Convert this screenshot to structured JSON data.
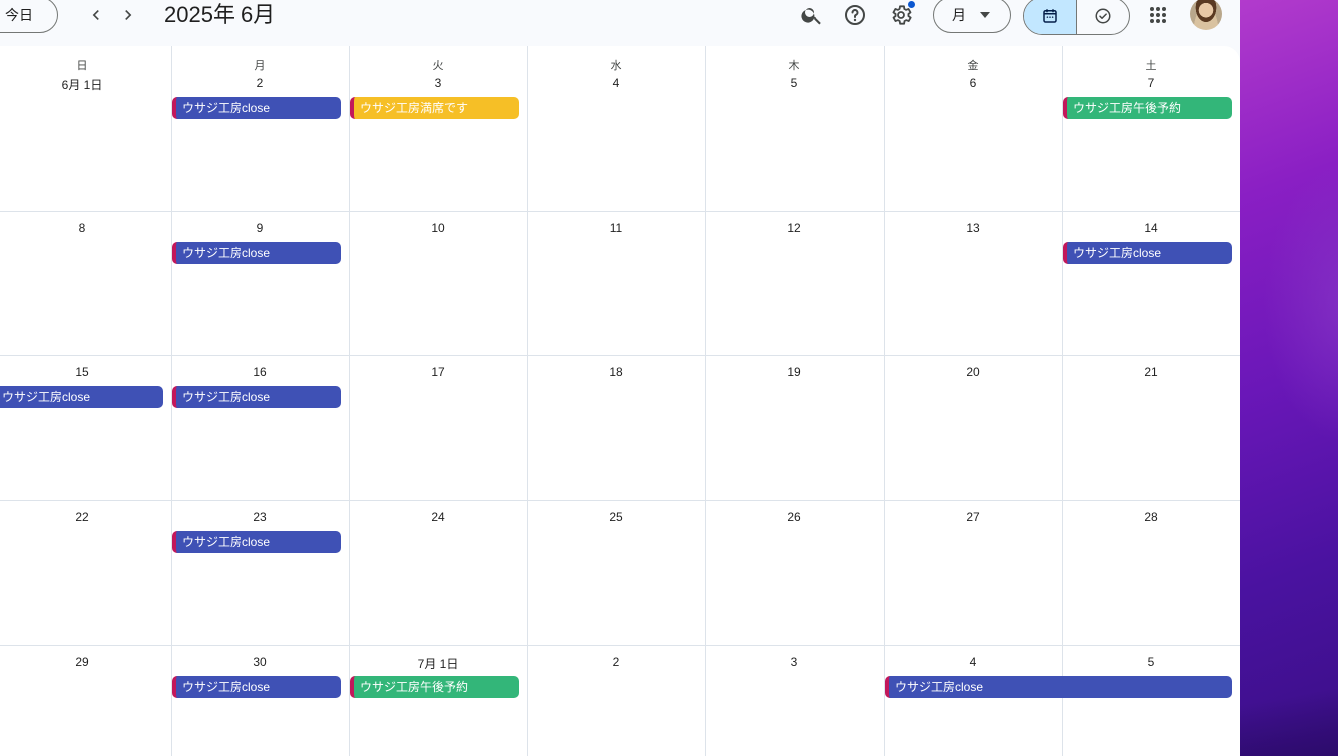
{
  "header": {
    "today_label": "今日",
    "title": "2025年 6月",
    "view_label": "月"
  },
  "weekdays": [
    "日",
    "月",
    "火",
    "水",
    "木",
    "金",
    "土"
  ],
  "weeks": [
    [
      "6月 1日",
      "2",
      "3",
      "4",
      "5",
      "6",
      "7"
    ],
    [
      "8",
      "9",
      "10",
      "11",
      "12",
      "13",
      "14"
    ],
    [
      "15",
      "16",
      "17",
      "18",
      "19",
      "20",
      "21"
    ],
    [
      "22",
      "23",
      "24",
      "25",
      "26",
      "27",
      "28"
    ],
    [
      "29",
      "30",
      "7月 1日",
      "2",
      "3",
      "4",
      "5"
    ]
  ],
  "events": [
    {
      "week": 0,
      "day": 1,
      "span": 1,
      "title": "ウサジ工房close",
      "color": "blue"
    },
    {
      "week": 0,
      "day": 2,
      "span": 1,
      "title": "ウサジ工房満席です",
      "color": "yellow"
    },
    {
      "week": 0,
      "day": 6,
      "span": 1,
      "title": "ウサジ工房午後予約",
      "color": "green"
    },
    {
      "week": 1,
      "day": 1,
      "span": 1,
      "title": "ウサジ工房close",
      "color": "blue"
    },
    {
      "week": 1,
      "day": 6,
      "span": 1,
      "title": "ウサジ工房close",
      "color": "blue"
    },
    {
      "week": 2,
      "day": 0,
      "span": 1,
      "title": "ウサジ工房close",
      "color": "blue",
      "continued": true
    },
    {
      "week": 2,
      "day": 1,
      "span": 1,
      "title": "ウサジ工房close",
      "color": "blue"
    },
    {
      "week": 3,
      "day": 1,
      "span": 1,
      "title": "ウサジ工房close",
      "color": "blue"
    },
    {
      "week": 4,
      "day": 1,
      "span": 1,
      "title": "ウサジ工房close",
      "color": "blue"
    },
    {
      "week": 4,
      "day": 2,
      "span": 1,
      "title": "ウサジ工房午後予約",
      "color": "green"
    },
    {
      "week": 4,
      "day": 5,
      "span": 2,
      "title": "ウサジ工房close",
      "color": "blue"
    }
  ],
  "colors": {
    "blue": "#3f51b5",
    "yellow": "#f6bf26",
    "green": "#33b679",
    "accent_border": "#c2185b",
    "selected_view": "#c2e7ff"
  },
  "icons": [
    "chevron-left-icon",
    "chevron-right-icon",
    "search-icon",
    "help-icon",
    "gear-icon",
    "dropdown-arrow-icon",
    "calendar-icon",
    "tasks-check-icon",
    "apps-grid-icon",
    "avatar"
  ]
}
